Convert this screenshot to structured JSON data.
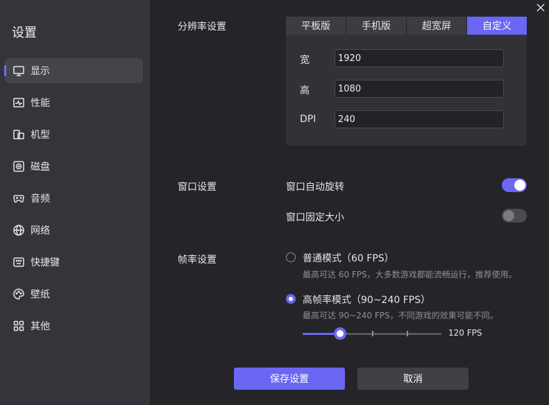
{
  "colors": {
    "accent": "#6b66f4",
    "sidebar_bg": "#34343a",
    "main_bg": "#242429"
  },
  "sidebar": {
    "title": "设置",
    "items": [
      {
        "label": "显示",
        "icon": "monitor-icon",
        "active": true
      },
      {
        "label": "性能",
        "icon": "pulse-icon",
        "active": false
      },
      {
        "label": "机型",
        "icon": "device-icon",
        "active": false
      },
      {
        "label": "磁盘",
        "icon": "disk-icon",
        "active": false
      },
      {
        "label": "音频",
        "icon": "gamepad-icon",
        "active": false
      },
      {
        "label": "网络",
        "icon": "globe-icon",
        "active": false
      },
      {
        "label": "快捷键",
        "icon": "keyboard-icon",
        "active": false
      },
      {
        "label": "壁纸",
        "icon": "palette-icon",
        "active": false
      },
      {
        "label": "其他",
        "icon": "grid-icon",
        "active": false
      }
    ]
  },
  "resolution": {
    "label": "分辨率设置",
    "tabs": [
      "平板版",
      "手机版",
      "超宽屏",
      "自定义"
    ],
    "active_tab": "自定义",
    "width_label": "宽",
    "width_value": "1920",
    "height_label": "高",
    "height_value": "1080",
    "dpi_label": "DPI",
    "dpi_value": "240"
  },
  "window": {
    "label": "窗口设置",
    "auto_rotate_label": "窗口自动旋转",
    "auto_rotate_on": true,
    "fixed_size_label": "窗口固定大小",
    "fixed_size_on": false
  },
  "framerate": {
    "label": "帧率设置",
    "normal_title": "普通模式（60 FPS）",
    "normal_desc": "最高可达 60 FPS，大多数游戏都能流畅运行，推荐使用。",
    "normal_selected": false,
    "high_title": "高帧率模式（90~240 FPS）",
    "high_desc": "最高可达 90~240 FPS，不同游戏的效果可能不同。",
    "high_selected": true,
    "slider_fraction": 0.27,
    "slider_value_label": "120 FPS"
  },
  "buttons": {
    "save_label": "保存设置",
    "cancel_label": "取消"
  }
}
